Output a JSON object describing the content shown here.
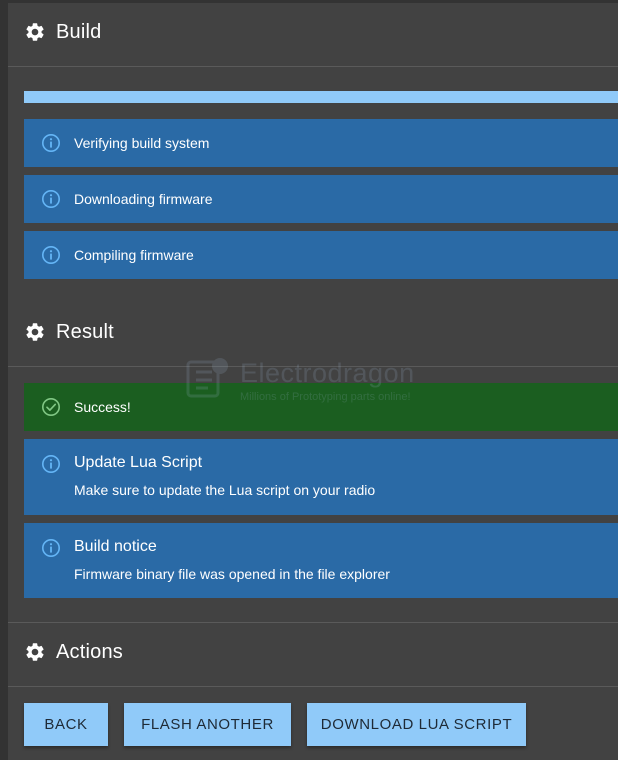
{
  "build": {
    "title": "Build",
    "progress": 1.0,
    "steps": [
      {
        "label": "Verifying build system",
        "icon": "info-icon"
      },
      {
        "label": "Downloading firmware",
        "icon": "info-icon"
      },
      {
        "label": "Compiling firmware",
        "icon": "info-icon"
      }
    ]
  },
  "result": {
    "title": "Result",
    "success": {
      "label": "Success!",
      "icon": "check-circle-icon"
    },
    "lua": {
      "title": "Update Lua Script",
      "body": "Make sure to update the Lua script on your radio",
      "icon": "info-icon"
    },
    "notice": {
      "title": "Build notice",
      "body": "Firmware binary file was opened in the file explorer",
      "icon": "info-icon"
    }
  },
  "actions": {
    "title": "Actions",
    "back_label": "BACK",
    "flash_another_label": "FLASH ANOTHER",
    "download_lua_label": "DOWNLOAD LUA SCRIPT"
  },
  "watermark": {
    "title": "Electrodragon",
    "subtitle": "Millions of Prototyping parts online!"
  },
  "colors": {
    "background": "#424242",
    "info": "#2a6aa6",
    "success": "#1b5e20",
    "accent": "#90caf9",
    "info_icon": "#64b5f6",
    "success_icon": "#81c784"
  }
}
